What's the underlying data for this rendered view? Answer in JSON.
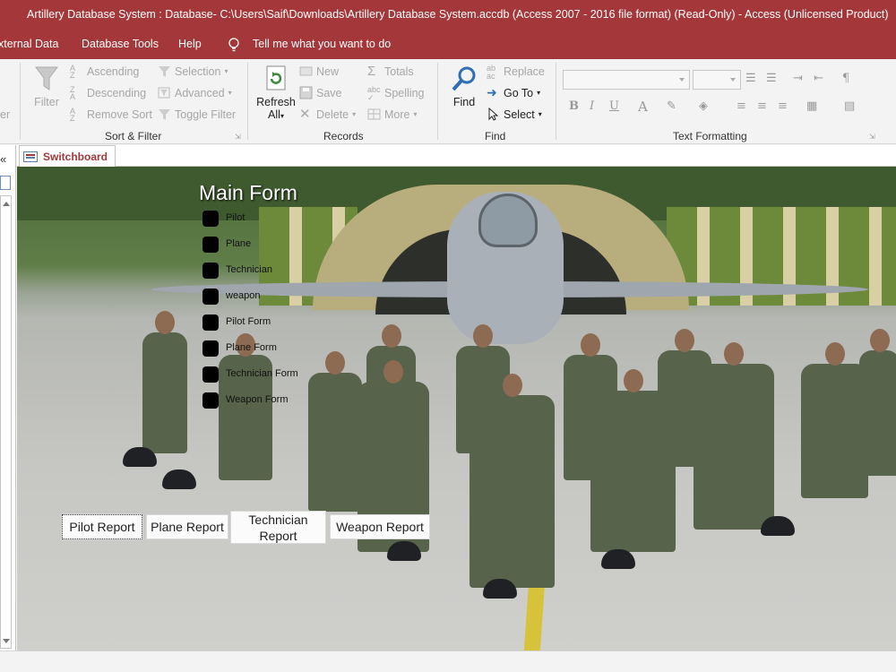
{
  "window": {
    "title": "Artillery Database System : Database- C:\\Users\\Saif\\Downloads\\Artillery Database System.accdb (Access 2007 - 2016 file format) (Read-Only)  -  Access (Unlicensed Product)"
  },
  "menu": {
    "items": [
      "xternal Data",
      "Database Tools",
      "Help"
    ],
    "tell_me": "Tell me what you want to do"
  },
  "ribbon": {
    "sort_filter": {
      "filter_label": "Filter",
      "ascending": "Ascending",
      "descending": "Descending",
      "remove_sort": "Remove Sort",
      "selection": "Selection",
      "advanced": "Advanced",
      "toggle_filter": "Toggle Filter",
      "group_label": "Sort & Filter",
      "cut_label": "er"
    },
    "records": {
      "refresh_line1": "Refresh",
      "refresh_line2": "All",
      "new": "New",
      "save": "Save",
      "delete": "Delete",
      "totals": "Totals",
      "spelling": "Spelling",
      "more": "More",
      "group_label": "Records"
    },
    "find": {
      "find_label": "Find",
      "replace": "Replace",
      "goto": "Go To",
      "select": "Select",
      "group_label": "Find"
    },
    "text_formatting": {
      "bold": "B",
      "italic": "I",
      "underline": "U",
      "font_color": "A",
      "group_label": "Text Formatting"
    }
  },
  "navpane": {
    "collapse_glyph": "«"
  },
  "tabs": [
    {
      "label": "Switchboard"
    }
  ],
  "form": {
    "title": "Main Form",
    "menu_items": [
      "Pilot",
      "Plane",
      "Technician",
      "weapon",
      "Pilot Form",
      "Plane Form",
      "Technician Form",
      "Weapon Form"
    ],
    "reports": {
      "pilot": "Pilot Report",
      "plane": "Plane Report",
      "technician": "Technician Report",
      "weapon": "Weapon Report"
    }
  },
  "colors": {
    "brand": "#a4373a",
    "tab_text": "#a4373a",
    "ribbon_bg": "#f3f3f3"
  }
}
